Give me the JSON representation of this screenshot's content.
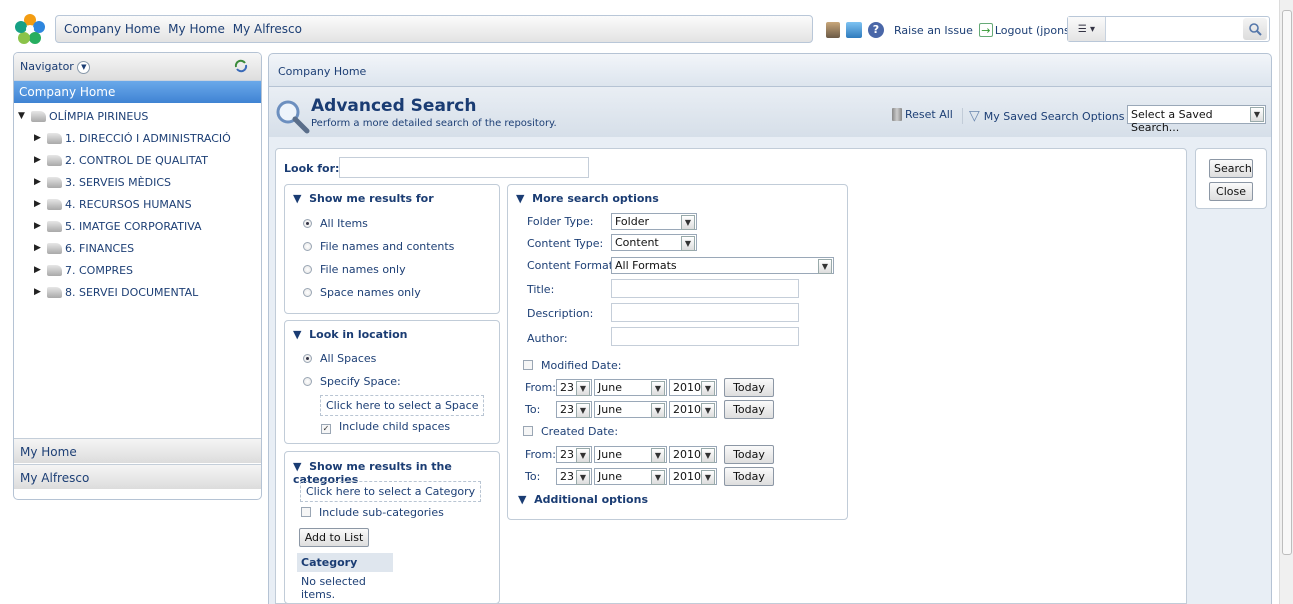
{
  "header": {
    "nav_links": [
      "Company Home",
      "My Home",
      "My Alfresco"
    ],
    "raise_issue": "Raise an Issue",
    "logout": "Logout (jpons)",
    "search_value": ""
  },
  "navigator": {
    "title": "Navigator",
    "company_home": "Company Home",
    "root": "OLÍMPIA PIRINEUS",
    "items": [
      "1. DIRECCIÓ I ADMINISTRACIÓ",
      "2. CONTROL DE QUALITAT",
      "3. SERVEIS MÈDICS",
      "4. RECURSOS HUMANS",
      "5. IMATGE CORPORATIVA",
      "6. FINANCES",
      "7. COMPRES",
      "8. SERVEI DOCUMENTAL"
    ],
    "my_home": "My Home",
    "my_alfresco": "My Alfresco"
  },
  "breadcrumb": "Company Home",
  "page": {
    "title": "Advanced Search",
    "subtitle": "Perform a more detailed search of the repository.",
    "reset_all": "Reset All",
    "saved_options": "My Saved Search Options",
    "saved_select": "Select a Saved Search..."
  },
  "buttons": {
    "search": "Search",
    "close": "Close"
  },
  "lookfor": {
    "label": "Look for",
    "value": ""
  },
  "results_for": {
    "title": "Show me results for",
    "options": [
      "All Items",
      "File names and contents",
      "File names only",
      "Space names only"
    ],
    "selected": 0
  },
  "location": {
    "title": "Look in location",
    "options": [
      "All Spaces",
      "Specify Space:"
    ],
    "selected": 0,
    "select_space": "Click here to select a Space",
    "include_child": "Include child spaces"
  },
  "categories": {
    "title": "Show me results in the categories",
    "select_category": "Click here to select a Category",
    "include_sub": "Include sub-categories",
    "add_button": "Add to List",
    "col_header": "Category",
    "empty": "No selected items."
  },
  "more_options": {
    "title": "More search options",
    "folder_type_label": "Folder Type:",
    "folder_type": "Folder",
    "content_type_label": "Content Type:",
    "content_type": "Content",
    "content_format_label": "Content Format:",
    "content_format": "All Formats",
    "title_label": "Title:",
    "description_label": "Description:",
    "author_label": "Author:",
    "modified_date": "Modified Date:",
    "created_date": "Created Date:",
    "from": "From:",
    "to": "To:",
    "day": "23",
    "month": "June",
    "year": "2010",
    "today": "Today",
    "additional": "Additional options"
  }
}
